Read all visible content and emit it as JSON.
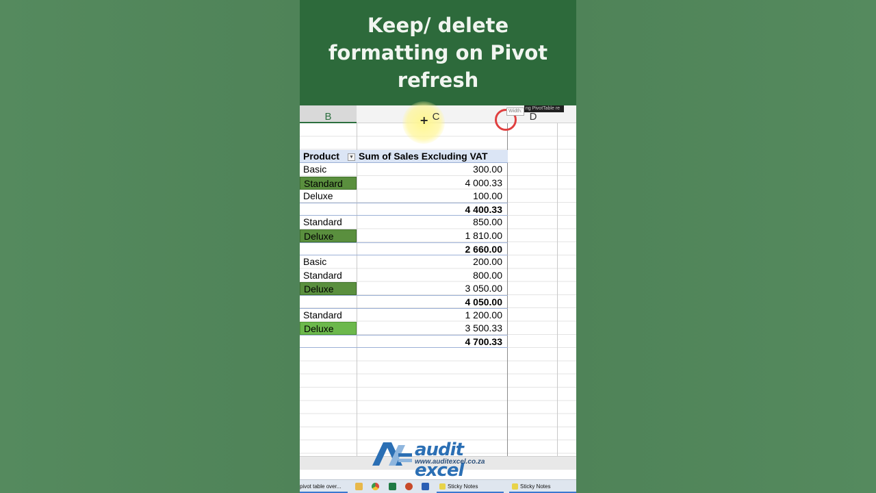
{
  "banner": {
    "title": "Keep/ delete formatting on Pivot refresh"
  },
  "columns": {
    "b": "B",
    "c": "C",
    "d": "D"
  },
  "tooltip": {
    "width_label": "Width:",
    "dark_label": "ng PivotTable re"
  },
  "pivot": {
    "header": {
      "product": "Product",
      "value": "Sum of Sales Excluding VAT"
    },
    "rows": [
      {
        "product": "Basic",
        "value": "300.00",
        "style": "plain"
      },
      {
        "product": "Standard",
        "value": "4 000.33",
        "style": "green-dark"
      },
      {
        "product": "Deluxe",
        "value": "100.00",
        "style": "plain"
      },
      {
        "product": "",
        "value": "4 400.33",
        "style": "subtotal"
      },
      {
        "product": "Standard",
        "value": "850.00",
        "style": "plain"
      },
      {
        "product": "Deluxe",
        "value": "1 810.00",
        "style": "green-dark"
      },
      {
        "product": "",
        "value": "2 660.00",
        "style": "subtotal"
      },
      {
        "product": "Basic",
        "value": "200.00",
        "style": "plain"
      },
      {
        "product": "Standard",
        "value": "800.00",
        "style": "plain"
      },
      {
        "product": "Deluxe",
        "value": "3 050.00",
        "style": "green-dark"
      },
      {
        "product": "",
        "value": "4 050.00",
        "style": "subtotal"
      },
      {
        "product": "Standard",
        "value": "1 200.00",
        "style": "plain"
      },
      {
        "product": "Deluxe",
        "value": "3 500.33",
        "style": "green-light"
      },
      {
        "product": "",
        "value": "4 700.33",
        "style": "subtotal"
      }
    ]
  },
  "logo": {
    "brand": "audit excel",
    "url": "www.auditexcel.co.za"
  },
  "taskbar": {
    "items": [
      {
        "label": "pivot table over...",
        "icon": "browser-tab-icon"
      },
      {
        "label": "",
        "icon": "file-explorer-icon"
      },
      {
        "label": "",
        "icon": "chrome-icon"
      },
      {
        "label": "",
        "icon": "excel-icon"
      },
      {
        "label": "",
        "icon": "powerpoint-icon"
      },
      {
        "label": "",
        "icon": "word-icon"
      },
      {
        "label": "Sticky Notes",
        "icon": "sticky-notes-icon"
      },
      {
        "label": "Sticky Notes",
        "icon": "sticky-notes-icon"
      }
    ]
  },
  "colors": {
    "banner_bg": "#2d6a3b",
    "highlight_dark": "#5a8f3e",
    "highlight_light": "#6cb84c",
    "pivot_header_bg": "#dbe5f5",
    "selected_column": "#2c6f3f"
  }
}
